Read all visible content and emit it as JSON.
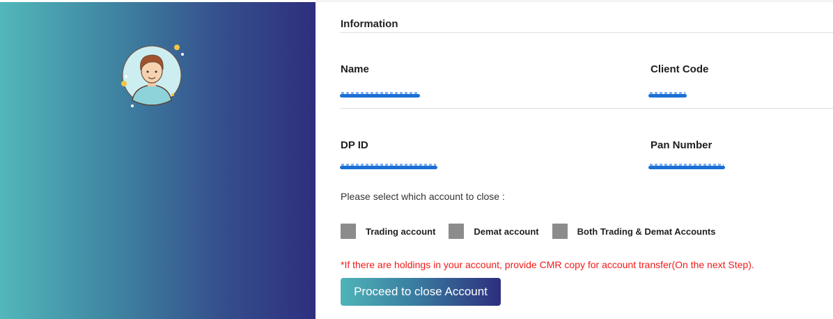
{
  "section": {
    "title": "Information"
  },
  "fields": {
    "name": {
      "label": "Name"
    },
    "client_code": {
      "label": "Client Code"
    },
    "dp_id": {
      "label": "DP ID"
    },
    "pan_number": {
      "label": "Pan Number"
    }
  },
  "prompt": "Please select which account to close :",
  "options": [
    {
      "label": "Trading account"
    },
    {
      "label": "Demat account"
    },
    {
      "label": "Both Trading & Demat Accounts"
    }
  ],
  "warning": "*If there are holdings in your account, provide CMR copy for account transfer(On the next Step).",
  "proceed_button": "Proceed to close Account",
  "colors": {
    "gradient_start": "#52b7ba",
    "gradient_end": "#2e2f7e",
    "warning": "#f21a1a",
    "masked_value": "#1b6fd6"
  }
}
